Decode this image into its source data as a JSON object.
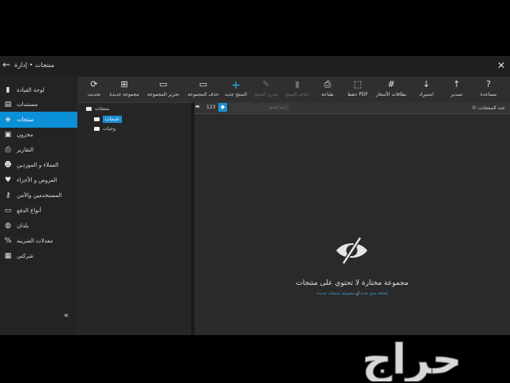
{
  "window": {
    "breadcrumb": "منتجات • إدارة",
    "back_icon": "arrow-left-icon",
    "close_icon": "close-icon"
  },
  "sidebar": {
    "items": [
      {
        "label": "لوحة القيادة",
        "icon": "chart-icon"
      },
      {
        "label": "مستندات",
        "icon": "document-icon"
      },
      {
        "label": "منتجات",
        "icon": "tag-icon",
        "active": true
      },
      {
        "label": "مخزون",
        "icon": "box-icon"
      },
      {
        "label": "التقارير",
        "icon": "printer-icon"
      },
      {
        "label": "العملاء و الموردين",
        "icon": "users-icon"
      },
      {
        "label": "العروض و الأجزاء",
        "icon": "heart-icon"
      },
      {
        "label": "المستخدمين والأمن",
        "icon": "key-icon"
      },
      {
        "label": "أنواع الدفع",
        "icon": "card-icon"
      },
      {
        "label": "بلدان",
        "icon": "globe-icon"
      },
      {
        "label": "معدلات الضريبة",
        "icon": "percent-icon"
      },
      {
        "label": "شركتي",
        "icon": "company-icon"
      }
    ],
    "collapse_icon": "double-chevron-left-icon"
  },
  "toolbar": {
    "items": [
      {
        "label": "تحديث",
        "glyph": "⟳",
        "icon": "refresh-icon"
      },
      {
        "label": "مجموعة جديدة",
        "glyph": "⊞",
        "icon": "new-group-icon"
      },
      {
        "label": "تحرير المجموعة",
        "glyph": "▭",
        "icon": "folder-icon"
      },
      {
        "label": "حذف المجموعة",
        "glyph": "▭",
        "icon": "folder-delete-icon"
      },
      {
        "label": "المنتج جديد",
        "glyph": "+",
        "icon": "plus-icon",
        "primary": true
      },
      {
        "label": "تحرير المنتج",
        "glyph": "✎",
        "icon": "pencil-icon",
        "disabled": true
      },
      {
        "label": "حذف المنتج",
        "glyph": "▮",
        "icon": "trash-icon",
        "disabled": true
      },
      {
        "label": "طباعة",
        "glyph": "⎙",
        "icon": "printer-icon"
      },
      {
        "label": "حفظ PDF",
        "glyph": "⬚",
        "icon": "pdf-icon"
      },
      {
        "label": "بطاقات الأسعار",
        "glyph": "#",
        "icon": "hash-icon"
      },
      {
        "label": "استيراد",
        "glyph": "↓",
        "icon": "import-icon"
      },
      {
        "label": "تصدير",
        "glyph": "↑",
        "icon": "export-icon"
      },
      {
        "label": "مساعدة",
        "glyph": "?",
        "icon": "help-icon"
      }
    ]
  },
  "tree": {
    "root": "منتجات",
    "children": [
      "خدمات",
      "وجبات"
    ],
    "selected": "خدمات"
  },
  "filterbar": {
    "view_icon": "view-list-icon",
    "count_chip": "123",
    "tag_icon": "tag-filter-icon",
    "search_placeholder": "اسم المنتج",
    "count_label": "عدد المنتجات: 0"
  },
  "empty_state": {
    "icon": "eye-off-icon",
    "message": "مجموعة مختارة لا تحتوي على منتجات",
    "link_add": "إضافة منتج جديد",
    "link_or": "أو",
    "link_group": "مجموعة منتجات جديدة"
  },
  "watermark": {
    "text": "حراج",
    "logo_icon": "haraj-logo-icon"
  }
}
